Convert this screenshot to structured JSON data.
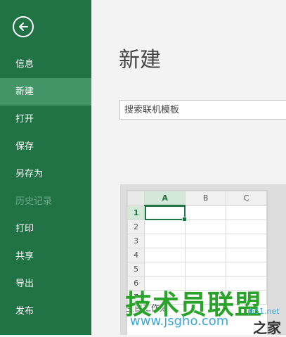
{
  "sidebar": {
    "back_icon": "back-arrow-icon",
    "items": [
      {
        "label": "信息",
        "state": "normal"
      },
      {
        "label": "新建",
        "state": "active"
      },
      {
        "label": "打开",
        "state": "normal"
      },
      {
        "label": "保存",
        "state": "normal"
      },
      {
        "label": "另存为",
        "state": "normal"
      },
      {
        "label": "历史记录",
        "state": "disabled"
      },
      {
        "label": "打印",
        "state": "normal"
      },
      {
        "label": "共享",
        "state": "normal"
      },
      {
        "label": "导出",
        "state": "normal"
      },
      {
        "label": "发布",
        "state": "normal"
      }
    ]
  },
  "main": {
    "title": "新建",
    "search": {
      "placeholder": "搜索联机模板",
      "value": ""
    },
    "template": {
      "columns": [
        "A",
        "B",
        "C"
      ],
      "rows": [
        "1",
        "2",
        "3",
        "4",
        "5",
        "6",
        "7"
      ],
      "selected_column": "A",
      "selected_row": "1",
      "caption": "空白工作簿"
    }
  },
  "watermark": {
    "main": "技术员联盟",
    "url": "www.jsgho.com",
    "small": "jb51.net",
    "home": "之家"
  },
  "colors": {
    "sidebar": "#217346",
    "active": "#439467",
    "watermark_green": "#2aa32a"
  }
}
